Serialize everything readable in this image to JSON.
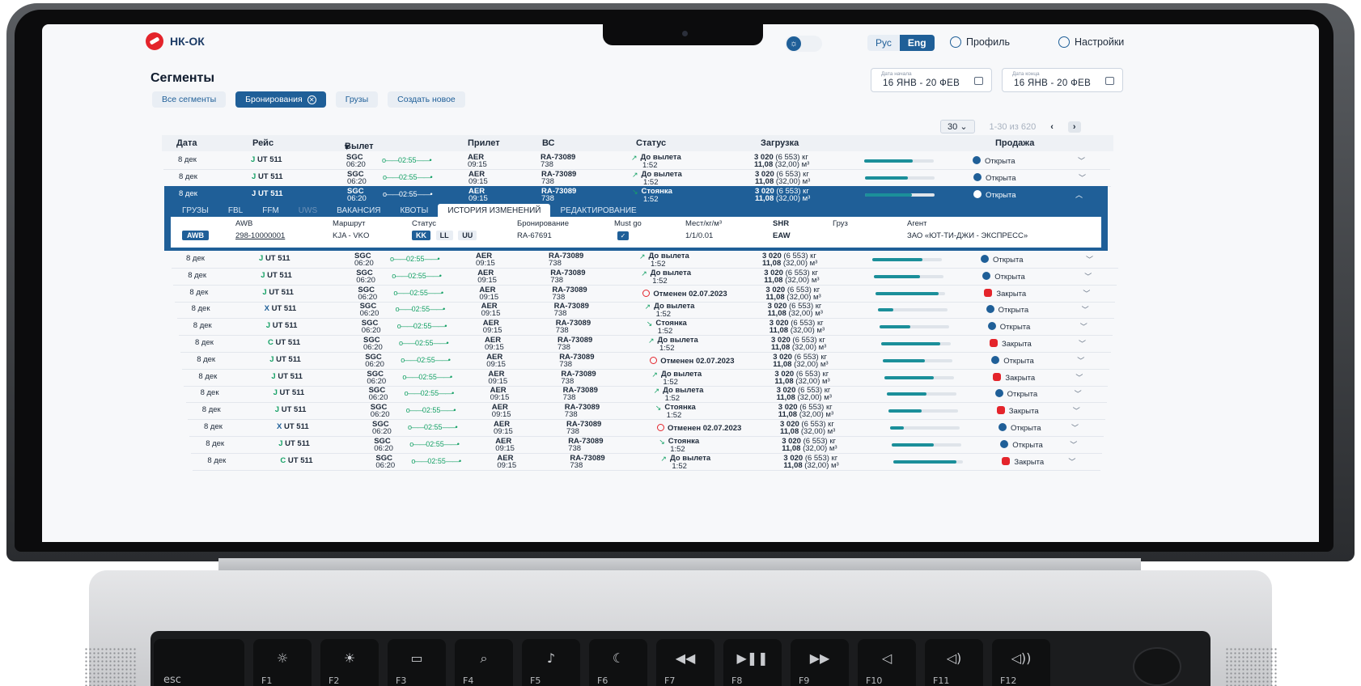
{
  "header": {
    "logo_text": "НК-ОК",
    "lang": {
      "ru": "Рус",
      "en": "Eng"
    },
    "profile_label": "Профиль",
    "settings_label": "Настройки"
  },
  "page": {
    "title": "Сегменты",
    "chips": {
      "all": "Все сегменты",
      "bookings": "Бронирования",
      "cargo": "Грузы",
      "create": "Создать новое"
    },
    "date_start": {
      "label": "Дата начала",
      "value": "16 ЯНВ - 20 ФЕВ"
    },
    "date_end": {
      "label": "Дата конца",
      "value": "16 ЯНВ - 20 ФЕВ"
    },
    "pager": {
      "per_page": "30",
      "range": "1-30 из 620"
    }
  },
  "table": {
    "headers": {
      "date": "Дата",
      "flight": "Рейс",
      "departure": "Вылет",
      "arrival": "Прилет",
      "aircraft": "ВС",
      "status": "Статус",
      "load": "Загрузка",
      "sale": "Продажа"
    },
    "rows": [
      {
        "date": "8 дек",
        "fl_icon": "J",
        "flight": "UT 511",
        "dep": "SGC",
        "dep_time": "06:20",
        "dur": "02:55",
        "arr": "AER",
        "arr_time": "09:15",
        "ac": "RA-73089",
        "ac_type": "738",
        "status": "До вылета",
        "status_sub": "1:52",
        "status_kind": "dep",
        "load1": "3 020",
        "load1b": "(6 553) кг",
        "load2": "11,08",
        "load2b": "(32,00) м³",
        "fill": 0.7,
        "sale": "Открыта",
        "sale_kind": "open"
      },
      {
        "date": "8 дек",
        "fl_icon": "J",
        "flight": "UT 511",
        "dep": "SGC",
        "dep_time": "06:20",
        "dur": "02:55",
        "arr": "AER",
        "arr_time": "09:15",
        "ac": "RA-73089",
        "ac_type": "738",
        "status": "До вылета",
        "status_sub": "1:52",
        "status_kind": "dep",
        "load1": "3 020",
        "load1b": "(6 553) кг",
        "load2": "11,08",
        "load2b": "(32,00) м³",
        "fill": 0.62,
        "sale": "Открыта",
        "sale_kind": "open"
      },
      {
        "date": "8 дек",
        "fl_icon": "J",
        "flight": "UT 511",
        "dep": "SGC",
        "dep_time": "06:20",
        "dur": "02:55",
        "arr": "AER",
        "arr_time": "09:15",
        "ac": "RA-73089",
        "ac_type": "738",
        "status": "Стоянка",
        "status_sub": "1:52",
        "status_kind": "park",
        "load1": "3 020",
        "load1b": "(6 553) кг",
        "load2": "11,08",
        "load2b": "(32,00) м³",
        "fill": 0.68,
        "sale": "Открыта",
        "sale_kind": "open"
      },
      {
        "date": "8 дек",
        "fl_icon": "J",
        "flight": "UT 511",
        "dep": "SGC",
        "dep_time": "06:20",
        "dur": "02:55",
        "arr": "AER",
        "arr_time": "09:15",
        "ac": "RA-73089",
        "ac_type": "738",
        "status": "До вылета",
        "status_sub": "1:52",
        "status_kind": "dep",
        "load1": "3 020",
        "load1b": "(6 553) кг",
        "load2": "11,08",
        "load2b": "(32,00) м³",
        "fill": 0.72,
        "sale": "Открыта",
        "sale_kind": "open"
      },
      {
        "date": "8 дек",
        "fl_icon": "J",
        "flight": "UT 511",
        "dep": "SGC",
        "dep_time": "06:20",
        "dur": "02:55",
        "arr": "AER",
        "arr_time": "09:15",
        "ac": "RA-73089",
        "ac_type": "738",
        "status": "До вылета",
        "status_sub": "1:52",
        "status_kind": "dep",
        "load1": "3 020",
        "load1b": "(6 553) кг",
        "load2": "11,08",
        "load2b": "(32,00) м³",
        "fill": 0.66,
        "sale": "Открыта",
        "sale_kind": "open"
      },
      {
        "date": "8 дек",
        "fl_icon": "J",
        "flight": "UT 511",
        "dep": "SGC",
        "dep_time": "06:20",
        "dur": "02:55",
        "arr": "AER",
        "arr_time": "09:15",
        "ac": "RA-73089",
        "ac_type": "738",
        "status": "Отменен 02.07.2023",
        "status_sub": "",
        "status_kind": "cancel",
        "load1": "3 020",
        "load1b": "(6 553) кг",
        "load2": "11,08",
        "load2b": "(32,00) м³",
        "fill": 0.9,
        "sale": "Закрыта",
        "sale_kind": "closed"
      },
      {
        "date": "8 дек",
        "fl_icon": "X",
        "flight": "UT 511",
        "dep": "SGC",
        "dep_time": "06:20",
        "dur": "02:55",
        "arr": "AER",
        "arr_time": "09:15",
        "ac": "RA-73089",
        "ac_type": "738",
        "status": "До вылета",
        "status_sub": "1:52",
        "status_kind": "dep",
        "load1": "3 020",
        "load1b": "(6 553) кг",
        "load2": "11,08",
        "load2b": "(32,00) м³",
        "fill": 0.22,
        "sale": "Открыта",
        "sale_kind": "open"
      },
      {
        "date": "8 дек",
        "fl_icon": "J",
        "flight": "UT 511",
        "dep": "SGC",
        "dep_time": "06:20",
        "dur": "02:55",
        "arr": "AER",
        "arr_time": "09:15",
        "ac": "RA-73089",
        "ac_type": "738",
        "status": "Стоянка",
        "status_sub": "1:52",
        "status_kind": "park",
        "load1": "3 020",
        "load1b": "(6 553) кг",
        "load2": "11,08",
        "load2b": "(32,00) м³",
        "fill": 0.45,
        "sale": "Открыта",
        "sale_kind": "open"
      },
      {
        "date": "8 дек",
        "fl_icon": "C",
        "flight": "UT 511",
        "dep": "SGC",
        "dep_time": "06:20",
        "dur": "02:55",
        "arr": "AER",
        "arr_time": "09:15",
        "ac": "RA-73089",
        "ac_type": "738",
        "status": "До вылета",
        "status_sub": "1:52",
        "status_kind": "dep",
        "load1": "3 020",
        "load1b": "(6 553) кг",
        "load2": "11,08",
        "load2b": "(32,00) м³",
        "fill": 0.85,
        "sale": "Закрыта",
        "sale_kind": "closed"
      },
      {
        "date": "8 дек",
        "fl_icon": "J",
        "flight": "UT 511",
        "dep": "SGC",
        "dep_time": "06:20",
        "dur": "02:55",
        "arr": "AER",
        "arr_time": "09:15",
        "ac": "RA-73089",
        "ac_type": "738",
        "status": "Отменен 02.07.2023",
        "status_sub": "",
        "status_kind": "cancel",
        "load1": "3 020",
        "load1b": "(6 553) кг",
        "load2": "11,08",
        "load2b": "(32,00) м³",
        "fill": 0.6,
        "sale": "Открыта",
        "sale_kind": "open"
      },
      {
        "date": "8 дек",
        "fl_icon": "J",
        "flight": "UT 511",
        "dep": "SGC",
        "dep_time": "06:20",
        "dur": "02:55",
        "arr": "AER",
        "arr_time": "09:15",
        "ac": "RA-73089",
        "ac_type": "738",
        "status": "До вылета",
        "status_sub": "1:52",
        "status_kind": "dep",
        "load1": "3 020",
        "load1b": "(6 553) кг",
        "load2": "11,08",
        "load2b": "(32,00) м³",
        "fill": 0.7,
        "sale": "Закрыта",
        "sale_kind": "closed"
      },
      {
        "date": "8 дек",
        "fl_icon": "J",
        "flight": "UT 511",
        "dep": "SGC",
        "dep_time": "06:20",
        "dur": "02:55",
        "arr": "AER",
        "arr_time": "09:15",
        "ac": "RA-73089",
        "ac_type": "738",
        "status": "До вылета",
        "status_sub": "1:52",
        "status_kind": "dep",
        "load1": "3 020",
        "load1b": "(6 553) кг",
        "load2": "11,08",
        "load2b": "(32,00) м³",
        "fill": 0.58,
        "sale": "Открыта",
        "sale_kind": "open"
      },
      {
        "date": "8 дек",
        "fl_icon": "J",
        "flight": "UT 511",
        "dep": "SGC",
        "dep_time": "06:20",
        "dur": "02:55",
        "arr": "AER",
        "arr_time": "09:15",
        "ac": "RA-73089",
        "ac_type": "738",
        "status": "Стоянка",
        "status_sub": "1:52",
        "status_kind": "park",
        "load1": "3 020",
        "load1b": "(6 553) кг",
        "load2": "11,08",
        "load2b": "(32,00) м³",
        "fill": 0.48,
        "sale": "Закрыта",
        "sale_kind": "closed"
      },
      {
        "date": "8 дек",
        "fl_icon": "X",
        "flight": "UT 511",
        "dep": "SGC",
        "dep_time": "06:20",
        "dur": "02:55",
        "arr": "AER",
        "arr_time": "09:15",
        "ac": "RA-73089",
        "ac_type": "738",
        "status": "Отменен 02.07.2023",
        "status_sub": "",
        "status_kind": "cancel",
        "load1": "3 020",
        "load1b": "(6 553) кг",
        "load2": "11,08",
        "load2b": "(32,00) м³",
        "fill": 0.2,
        "sale": "Открыта",
        "sale_kind": "open"
      },
      {
        "date": "8 дек",
        "fl_icon": "J",
        "flight": "UT 511",
        "dep": "SGC",
        "dep_time": "06:20",
        "dur": "02:55",
        "arr": "AER",
        "arr_time": "09:15",
        "ac": "RA-73089",
        "ac_type": "738",
        "status": "Стоянка",
        "status_sub": "1:52",
        "status_kind": "park",
        "load1": "3 020",
        "load1b": "(6 553) кг",
        "load2": "11,08",
        "load2b": "(32,00) м³",
        "fill": 0.6,
        "sale": "Открыта",
        "sale_kind": "open"
      },
      {
        "date": "8 дек",
        "fl_icon": "C",
        "flight": "UT 511",
        "dep": "SGC",
        "dep_time": "06:20",
        "dur": "02:55",
        "arr": "AER",
        "arr_time": "09:15",
        "ac": "RA-73089",
        "ac_type": "738",
        "status": "До вылета",
        "status_sub": "1:52",
        "status_kind": "dep",
        "load1": "3 020",
        "load1b": "(6 553) кг",
        "load2": "11,08",
        "load2b": "(32,00) м³",
        "fill": 0.9,
        "sale": "Закрыта",
        "sale_kind": "closed"
      }
    ]
  },
  "detail": {
    "tabs": [
      "ГРУЗЫ",
      "FBL",
      "FFM",
      "UWS",
      "ВАКАНСИЯ",
      "КВОТЫ",
      "ИСТОРИЯ ИЗМЕНЕНИЙ",
      "РЕДАКТИРОВАНИЕ"
    ],
    "headers": {
      "awb": "AWB",
      "route": "Маршрут",
      "status": "Статус",
      "booking": "Бронирование",
      "must_go": "Must go",
      "places": "Мест/кг/м³",
      "shr": "SHR",
      "cargo": "Груз",
      "agent": "Агент"
    },
    "values": {
      "awb_tag": "AWB",
      "awb_number": "298-10000001",
      "route": "KJA - VKO",
      "status_tags": [
        "KK",
        "LL",
        "UU"
      ],
      "booking": "RA-67691",
      "places": "1/1/0.01",
      "shr": "EAW",
      "cargo": "",
      "agent": "ЗАО «ЮТ-ТИ-ДЖИ - ЭКСПРЕСС»"
    }
  },
  "keyboard": {
    "keys": [
      {
        "label": "esc",
        "glyph": ""
      },
      {
        "label": "F1",
        "glyph": "☼"
      },
      {
        "label": "F2",
        "glyph": "☀"
      },
      {
        "label": "F3",
        "glyph": "▭"
      },
      {
        "label": "F4",
        "glyph": "⌕"
      },
      {
        "label": "F5",
        "glyph": "♪"
      },
      {
        "label": "F6",
        "glyph": "☾"
      },
      {
        "label": "F7",
        "glyph": "◀◀"
      },
      {
        "label": "F8",
        "glyph": "▶❚❚"
      },
      {
        "label": "F9",
        "glyph": "▶▶"
      },
      {
        "label": "F10",
        "glyph": "◁"
      },
      {
        "label": "F11",
        "glyph": "◁)"
      },
      {
        "label": "F12",
        "glyph": "◁))"
      }
    ]
  },
  "colors": {
    "brand": "#1f5f98",
    "accent_green": "#17a267",
    "danger": "#e4242b"
  }
}
